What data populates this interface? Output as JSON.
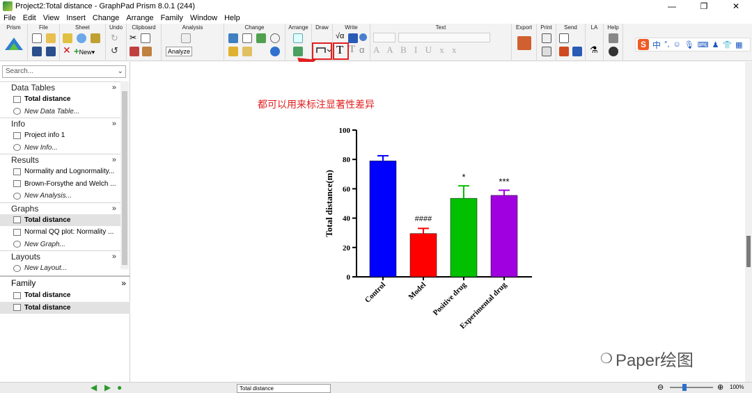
{
  "window": {
    "title": "Project2:Total distance - GraphPad Prism 8.0.1 (244)",
    "minimize": "—",
    "restore": "❐",
    "close": "✕"
  },
  "menu": [
    "File",
    "Edit",
    "View",
    "Insert",
    "Change",
    "Arrange",
    "Family",
    "Window",
    "Help"
  ],
  "toolbar_groups": [
    "Prism",
    "File",
    "Sheet",
    "Undo",
    "Clipboard",
    "Analysis",
    "Change",
    "Arrange",
    "Draw",
    "Write",
    "Text",
    "Export",
    "Print",
    "Send",
    "LA",
    "Help"
  ],
  "toolbar": {
    "new_label": "New",
    "analyze_label": "Analyze",
    "write_sqrt": "√α",
    "write_T": "T",
    "write_T2": "T",
    "write_alpha": "α",
    "ime_label": "中"
  },
  "annotation": {
    "text": "都可以用来标注显著性差异",
    "color": "#e02020"
  },
  "sidebar": {
    "search_placeholder": "Search...",
    "sections": [
      {
        "title": "Data Tables",
        "items": [
          {
            "label": "Total distance",
            "style": "bold"
          },
          {
            "label": "New Data Table...",
            "style": "ital"
          }
        ]
      },
      {
        "title": "Info",
        "items": [
          {
            "label": "Project info 1",
            "style": "normal"
          },
          {
            "label": "New Info...",
            "style": "ital"
          }
        ]
      },
      {
        "title": "Results",
        "items": [
          {
            "label": "Normality and Lognormality...",
            "style": "normal"
          },
          {
            "label": "Brown-Forsythe and Welch ...",
            "style": "normal"
          },
          {
            "label": "New Analysis...",
            "style": "ital"
          }
        ]
      },
      {
        "title": "Graphs",
        "items": [
          {
            "label": "Total distance",
            "style": "bold"
          },
          {
            "label": "Normal QQ plot: Normality ...",
            "style": "normal"
          },
          {
            "label": "New Graph...",
            "style": "ital"
          }
        ]
      },
      {
        "title": "Layouts",
        "items": [
          {
            "label": "New Layout...",
            "style": "ital"
          }
        ]
      }
    ],
    "family": {
      "title": "Family",
      "items": [
        {
          "label": "Total distance",
          "style": "bold"
        },
        {
          "label": "Total distance",
          "style": "bold"
        }
      ]
    }
  },
  "status": {
    "sheet_name": "Total distance",
    "zoom": "100%"
  },
  "watermark": "Paper绘图",
  "chart_data": {
    "type": "bar",
    "categories": [
      "Control",
      "Model",
      "Positive drug",
      "Experimental drug"
    ],
    "values": [
      79,
      29.5,
      53.5,
      55.5
    ],
    "errors": [
      3.5,
      3.5,
      8.5,
      3.5
    ],
    "significance": [
      "",
      "####",
      "*",
      "***"
    ],
    "colors": [
      "#0000ff",
      "#ff0000",
      "#00c000",
      "#a000e0"
    ],
    "ylabel": "Total distance(m)",
    "ylim": [
      0,
      100
    ],
    "yticks": [
      0,
      20,
      40,
      60,
      80,
      100
    ]
  }
}
